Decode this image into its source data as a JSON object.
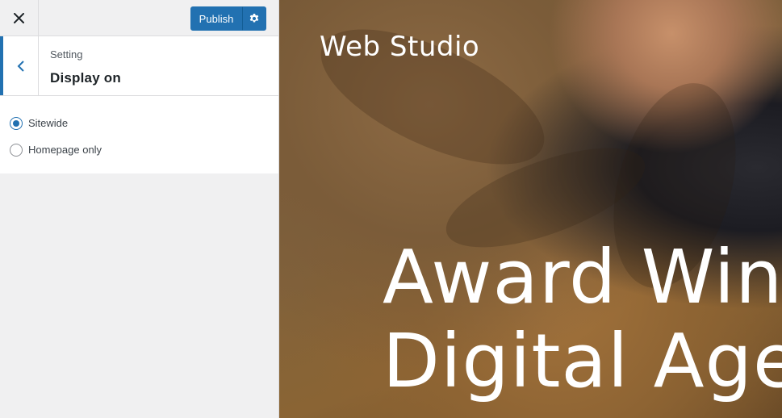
{
  "topbar": {
    "close_icon": "close-icon",
    "publish_label": "Publish",
    "publish_settings_icon": "gear-icon",
    "accent": "#2271b1"
  },
  "section": {
    "back_icon": "chevron-left-icon",
    "subtitle": "Setting",
    "title": "Display on"
  },
  "options": [
    {
      "label": "Sitewide",
      "selected": true
    },
    {
      "label": "Homepage only",
      "selected": false
    }
  ],
  "preview": {
    "site_title": "Web Studio",
    "hero_line1": "Award Win",
    "hero_line2": "Digital Age"
  }
}
